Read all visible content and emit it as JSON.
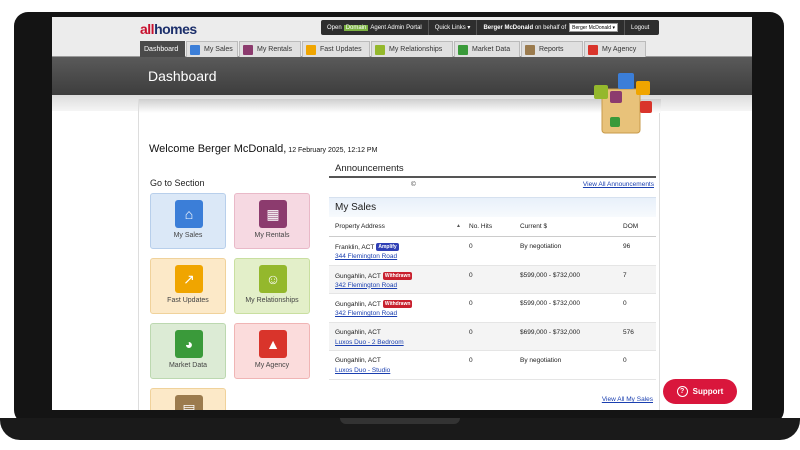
{
  "app": {
    "logo_part1": "all",
    "logo_part2": "homes"
  },
  "portal": {
    "open_label": "Open",
    "domain_label": "Domain",
    "portal_label": "Agent Admin Portal",
    "quick_links": "Quick Links ▾",
    "user_text": "Berger McDonald",
    "on_behalf": "on behalf of",
    "behalf_select": "Berger McDonald",
    "logout": "Logout"
  },
  "tabs": [
    {
      "label": "Dashboard",
      "color": "#4a4a4a",
      "icon": "none"
    },
    {
      "label": "My Sales",
      "color": "#3b7ed8",
      "icon": "house-icon"
    },
    {
      "label": "My Rentals",
      "color": "#8c3b6e",
      "icon": "building-icon"
    },
    {
      "label": "Fast Updates",
      "color": "#f0a500",
      "icon": "arrow-up-icon"
    },
    {
      "label": "My Relationships",
      "color": "#94b82c",
      "icon": "people-icon"
    },
    {
      "label": "Market Data",
      "color": "#3a9a3a",
      "icon": "pie-chart-icon"
    },
    {
      "label": "Reports",
      "color": "#9b7b4e",
      "icon": "report-icon"
    },
    {
      "label": "My Agency",
      "color": "#d9342b",
      "icon": "agent-icon"
    }
  ],
  "header": {
    "title": "Dashboard"
  },
  "welcome": {
    "text": "Welcome Berger McDonald,",
    "date": " 12 February 2025, 12:12 PM"
  },
  "goto": {
    "title": "Go to Section",
    "tiles": [
      {
        "label": "My Sales",
        "icon": "house-icon",
        "color": "#3b7ed8"
      },
      {
        "label": "My Rentals",
        "icon": "building-icon",
        "color": "#8c3b6e"
      },
      {
        "label": "Fast Updates",
        "icon": "arrow-up-icon",
        "color": "#f0a500"
      },
      {
        "label": "My Relationships",
        "icon": "people-icon",
        "color": "#94b82c"
      },
      {
        "label": "Market Data",
        "icon": "pie-chart-icon",
        "color": "#3a9a3a"
      },
      {
        "label": "My Agency",
        "icon": "agent-icon",
        "color": "#d9342b"
      },
      {
        "label": "",
        "icon": "report-icon",
        "color": "#9b7b4e"
      }
    ]
  },
  "announcements": {
    "title": "Announcements",
    "copy": "©",
    "view_all": "View All Announcements"
  },
  "sales": {
    "title": "My Sales",
    "columns": {
      "address": "Property Address",
      "hits": "No. Hits",
      "current": "Current $",
      "dom": "DOM"
    },
    "rows": [
      {
        "suburb": "Franklin, ACT",
        "badge": "Amplify",
        "street": "344 Flemington Road",
        "hits": "0",
        "current": "By negotiation",
        "dom": "96"
      },
      {
        "suburb": "Gungahlin, ACT",
        "badge": "Withdrawn",
        "street": "342 Flemington Road",
        "hits": "0",
        "current": "$599,000 - $732,000",
        "dom": "7"
      },
      {
        "suburb": "Gungahlin, ACT",
        "badge": "Withdrawn",
        "street": "342 Flemington Road",
        "hits": "0",
        "current": "$599,000 - $732,000",
        "dom": "0"
      },
      {
        "suburb": "Gungahlin, ACT",
        "badge": "",
        "street": "Luxos Duo - 2 Bedroom",
        "hits": "0",
        "current": "$699,000 - $732,000",
        "dom": "576"
      },
      {
        "suburb": "Gungahlin, ACT",
        "badge": "",
        "street": "Luxos Duo - Studio",
        "hits": "0",
        "current": "By negotiation",
        "dom": "0"
      }
    ],
    "view_all": "View All My Sales"
  },
  "support": {
    "label": "Support"
  }
}
